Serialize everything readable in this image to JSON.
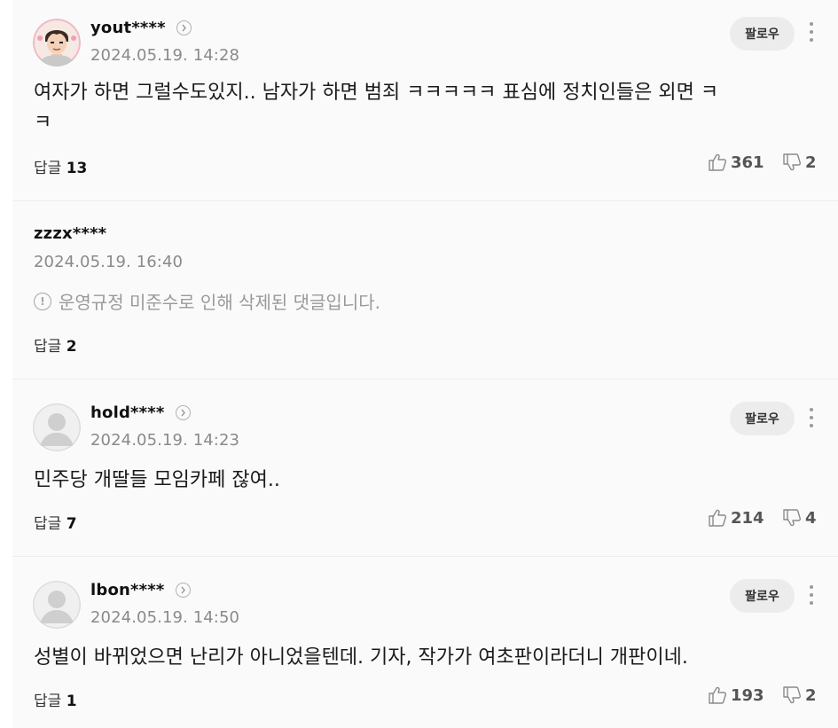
{
  "comments": [
    {
      "username": "yout****",
      "date": "2024.05.19. 14:28",
      "follow_label": "팔로우",
      "body_line1": "여자가 하면 그럴수도있지.. 남자가 하면 범죄 ㅋㅋㅋㅋㅋ 표심에 정치인들은 외면 ㅋ",
      "body_line2": "ㅋ",
      "reply_label": "답글",
      "reply_count": "13",
      "likes": "361",
      "dislikes": "2"
    },
    {
      "username": "zzzx****",
      "date": "2024.05.19. 16:40",
      "deleted_notice": "운영규정 미준수로 인해 삭제된 댓글입니다.",
      "reply_label": "답글",
      "reply_count": "2"
    },
    {
      "username": "hold****",
      "date": "2024.05.19. 14:23",
      "follow_label": "팔로우",
      "body": "민주당 개딸들 모임카페 잖여..",
      "reply_label": "답글",
      "reply_count": "7",
      "likes": "214",
      "dislikes": "4"
    },
    {
      "username": "lbon****",
      "date": "2024.05.19. 14:50",
      "follow_label": "팔로우",
      "body": "성별이 바뀌었으면 난리가 아니었을텐데. 기자, 작가가 여초판이라더니 개판이네.",
      "reply_label": "답글",
      "reply_count": "1",
      "likes": "193",
      "dislikes": "2"
    }
  ],
  "icons": {
    "thumb_up": "thumbs-up-icon",
    "thumb_down": "thumbs-down-icon",
    "more": "more-vertical-icon",
    "arrow": "chevron-right-icon",
    "warning": "warning-icon"
  },
  "colors": {
    "background": "#fafafa",
    "date_gray": "#8a8a8a",
    "follow_bg": "#ececec"
  }
}
